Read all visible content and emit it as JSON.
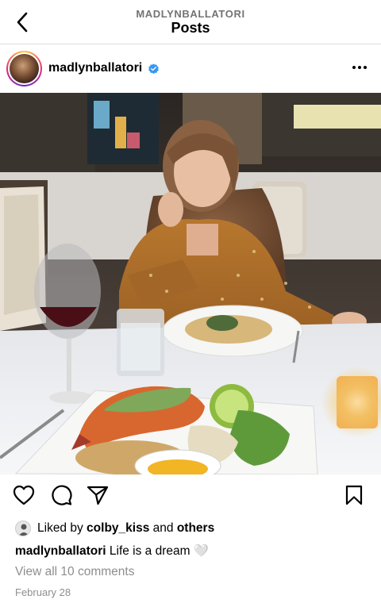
{
  "topbar": {
    "subtitle": "MADLYNBALLATORI",
    "title": "Posts",
    "back_icon": "chevron-left-icon"
  },
  "post": {
    "username": "madlynballatori",
    "verified": true,
    "more_icon": "more-horizontal-icon",
    "photo_desc_icon": "photo",
    "actions": {
      "like_icon": "heart-icon",
      "comment_icon": "comment-icon",
      "share_icon": "send-icon",
      "save_icon": "bookmark-icon"
    },
    "likes": {
      "prefix": "Liked by",
      "user": "colby_kiss",
      "conjunction": "and",
      "others": "others"
    },
    "caption": {
      "user": "madlynballatori",
      "text": "Life is a dream",
      "emoji": "🤍"
    },
    "comments_link": "View all 10 comments",
    "date": "February 28"
  },
  "colors": {
    "verified": "#3897f0",
    "muted": "#8e8e8e",
    "text": "#000000"
  }
}
